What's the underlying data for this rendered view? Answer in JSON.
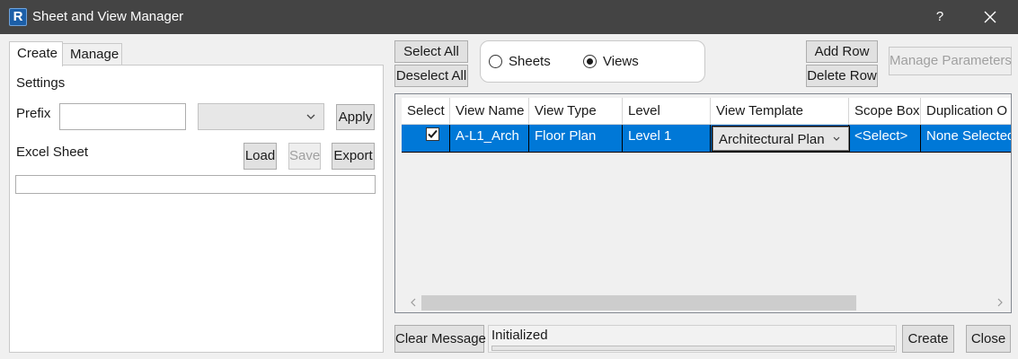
{
  "window": {
    "title": "Sheet and View Manager",
    "app_icon_letter": "R",
    "help_label": "?"
  },
  "tabs": [
    {
      "label": "Create",
      "active": true
    },
    {
      "label": "Manage",
      "active": false
    }
  ],
  "create_tab": {
    "settings_label": "Settings",
    "prefix_label": "Prefix",
    "prefix_value": "",
    "combo_value": "",
    "apply_label": "Apply",
    "excel_label": "Excel Sheet",
    "load_label": "Load",
    "save_label": "Save",
    "export_label": "Export",
    "excel_path": ""
  },
  "toolbar": {
    "select_all": "Select All",
    "deselect_all": "Deselect All",
    "add_row": "Add Row",
    "delete_row": "Delete Row",
    "manage_parameters": "Manage Parameters"
  },
  "mode": {
    "options": [
      "Sheets",
      "Views"
    ],
    "selected": "Views"
  },
  "table": {
    "columns": [
      "Select",
      "View Name",
      "View Type",
      "Level",
      "View Template",
      "Scope Box",
      "Duplication O"
    ],
    "rows": [
      {
        "selected": true,
        "view_name": "A-L1_Arch",
        "view_type": "Floor Plan",
        "level": "Level 1",
        "view_template": "Architectural Plan",
        "scope_box": "<Select>",
        "duplication": "None Selected"
      }
    ]
  },
  "footer": {
    "clear_message": "Clear Message",
    "status": "Initialized",
    "create": "Create",
    "close": "Close"
  },
  "colors": {
    "titlebar": "#444444",
    "selection": "#0078d7",
    "app_icon": "#1c5fa8"
  }
}
